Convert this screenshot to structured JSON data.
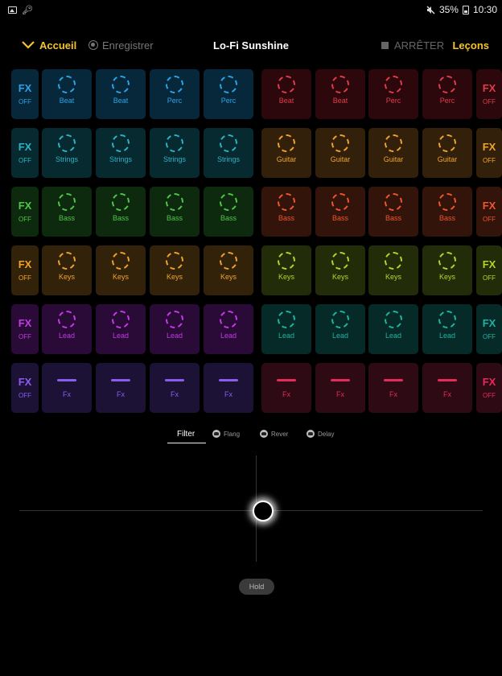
{
  "status": {
    "battery": "35%",
    "time": "10:30",
    "icons": [
      "image-icon",
      "key-icon",
      "mute-icon",
      "battery-icon"
    ]
  },
  "topbar": {
    "home_label": "Accueil",
    "record_label": "Enregistrer",
    "title": "Lo-Fi Sunshine",
    "stop_label": "ARRÊTER",
    "lessons_label": "Leçons"
  },
  "fx_title": "FX",
  "fx_state": "OFF",
  "rows": [
    {
      "left": {
        "color": "#2aa3e8",
        "bg": "#07273a",
        "labels": [
          "Beat",
          "Beat",
          "Perc",
          "Perc"
        ],
        "icon": "ring"
      },
      "right": {
        "color": "#e03b4a",
        "bg": "#2c080c",
        "labels": [
          "Beat",
          "Beat",
          "Perc",
          "Perc"
        ],
        "icon": "ring"
      }
    },
    {
      "left": {
        "color": "#2bb3c6",
        "bg": "#062a30",
        "labels": [
          "Strings",
          "Strings",
          "Strings",
          "Strings"
        ],
        "icon": "ring"
      },
      "right": {
        "color": "#f0a32c",
        "bg": "#33200a",
        "labels": [
          "Guitar",
          "Guitar",
          "Guitar",
          "Guitar"
        ],
        "icon": "ring"
      }
    },
    {
      "left": {
        "color": "#4fc64a",
        "bg": "#0e2a0e",
        "labels": [
          "Bass",
          "Bass",
          "Bass",
          "Bass"
        ],
        "icon": "ring"
      },
      "right": {
        "color": "#f2552e",
        "bg": "#33140a",
        "labels": [
          "Bass",
          "Bass",
          "Bass",
          "Bass"
        ],
        "icon": "ring"
      }
    },
    {
      "left": {
        "color": "#f0a32c",
        "bg": "#33220a",
        "labels": [
          "Keys",
          "Keys",
          "Keys",
          "Keys"
        ],
        "icon": "ring"
      },
      "right": {
        "color": "#b7d42a",
        "bg": "#222c08",
        "labels": [
          "Keys",
          "Keys",
          "Keys",
          "Keys"
        ],
        "icon": "ring"
      }
    },
    {
      "left": {
        "color": "#c43ae6",
        "bg": "#2a0a36",
        "labels": [
          "Lead",
          "Lead",
          "Lead",
          "Lead"
        ],
        "icon": "ring"
      },
      "right": {
        "color": "#1fb3a3",
        "bg": "#062a28",
        "labels": [
          "Lead",
          "Lead",
          "Lead",
          "Lead"
        ],
        "icon": "ring"
      }
    },
    {
      "left": {
        "color": "#8a5cf0",
        "bg": "#1c1236",
        "labels": [
          "Fx",
          "Fx",
          "Fx",
          "Fx"
        ],
        "icon": "dash"
      },
      "right": {
        "color": "#e62a5a",
        "bg": "#2e0a14",
        "labels": [
          "Fx",
          "Fx",
          "Fx",
          "Fx"
        ],
        "icon": "dash"
      }
    }
  ],
  "effects": {
    "tabs": [
      {
        "label": "Filter",
        "active": true,
        "icon": "none"
      },
      {
        "label": "Flang",
        "active": false,
        "icon": "hand-icon"
      },
      {
        "label": "Rever",
        "active": false,
        "icon": "hand-icon"
      },
      {
        "label": "Delay",
        "active": false,
        "icon": "hand-icon"
      }
    ],
    "hold_label": "Hold"
  }
}
